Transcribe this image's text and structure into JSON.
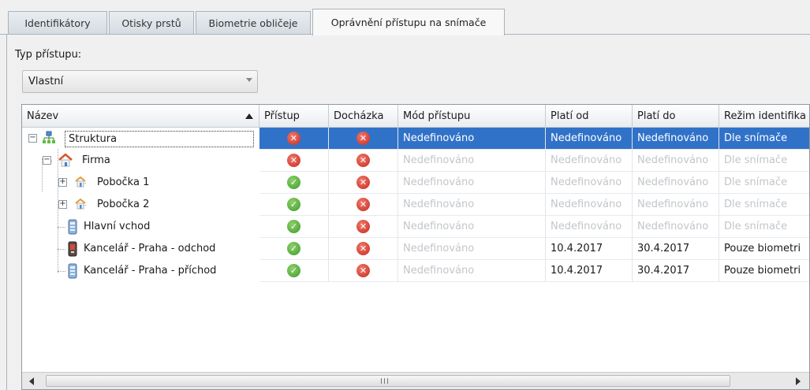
{
  "tabs": [
    {
      "label": "Identifikátory"
    },
    {
      "label": "Otisky prstů"
    },
    {
      "label": "Biometrie obličeje"
    },
    {
      "label": "Oprávnění přístupu na snímače"
    }
  ],
  "access_type": {
    "label": "Typ přístupu:",
    "value": "Vlastní"
  },
  "grid": {
    "columns": [
      {
        "label": "Název"
      },
      {
        "label": "Přístup"
      },
      {
        "label": "Docházka"
      },
      {
        "label": "Mód přístupu"
      },
      {
        "label": "Platí od"
      },
      {
        "label": "Platí do"
      },
      {
        "label": "Režim identifika"
      }
    ],
    "rows": [
      {
        "name": "Struktura",
        "icon": "network-tree-icon",
        "access": "deny",
        "attendance": "deny",
        "mode": "Nedefinováno",
        "from": "Nedefinováno",
        "to": "Nedefinováno",
        "regime": "Dle snímače",
        "selected": true
      },
      {
        "name": "Firma",
        "icon": "house-icon",
        "access": "deny",
        "attendance": "deny",
        "mode": "Nedefinováno",
        "from": "Nedefinováno",
        "to": "Nedefinováno",
        "regime": "Dle snímače"
      },
      {
        "name": "Pobočka 1",
        "icon": "branch-house-icon",
        "access": "ok",
        "attendance": "deny",
        "mode": "Nedefinováno",
        "from": "Nedefinováno",
        "to": "Nedefinováno",
        "regime": "Dle snímače"
      },
      {
        "name": "Pobočka 2",
        "icon": "branch-house-icon",
        "access": "ok",
        "attendance": "deny",
        "mode": "Nedefinováno",
        "from": "Nedefinováno",
        "to": "Nedefinováno",
        "regime": "Dle snímače"
      },
      {
        "name": "Hlavní vchod",
        "icon": "reader-icon",
        "access": "ok",
        "attendance": "deny",
        "mode": "Nedefinováno",
        "from": "Nedefinováno",
        "to": "Nedefinováno",
        "regime": "Dle snímače"
      },
      {
        "name": "Kancelář - Praha - odchod",
        "icon": "reader-dark-icon",
        "access": "ok",
        "attendance": "deny",
        "mode": "Nedefinováno",
        "from": "10.4.2017",
        "to": "30.4.2017",
        "regime": "Pouze biometri"
      },
      {
        "name": "Kancelář - Praha - příchod",
        "icon": "reader-icon",
        "access": "ok",
        "attendance": "deny",
        "mode": "Nedefinováno",
        "from": "10.4.2017",
        "to": "30.4.2017",
        "regime": "Pouze biometri"
      }
    ]
  },
  "colors": {
    "selection": "#3172c9",
    "deny": "#c62a1c",
    "ok": "#3e9a2d",
    "disabled_text": "#c2c6ca"
  }
}
